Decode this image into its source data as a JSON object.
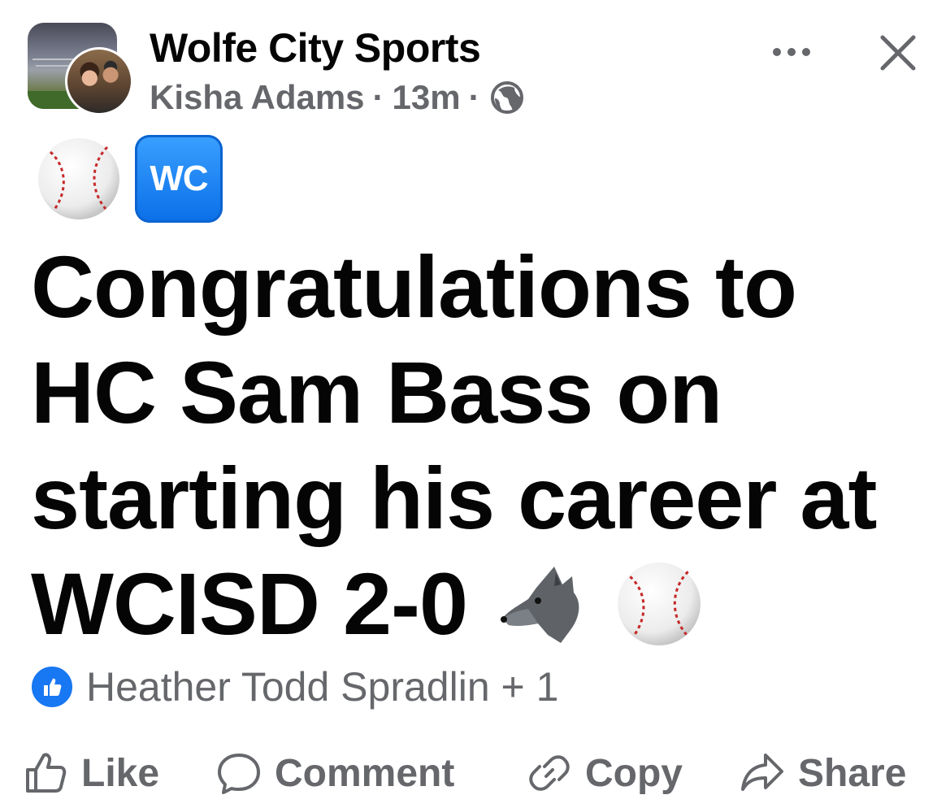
{
  "post": {
    "group_name": "Wolfe City Sports",
    "author": "Kisha Adams",
    "separator": "·",
    "time": "13m",
    "audience_icon": "globe-icon",
    "emoji_row": [
      "baseball-icon",
      "wc-icon"
    ],
    "wc_label": "WC",
    "body_lines": [
      "Congratulations to",
      "HC Sam Bass on",
      "starting his career at",
      "WCISD 2-0"
    ],
    "trailing_emoji": [
      "wolf-icon",
      "baseball-icon"
    ]
  },
  "reactions": {
    "icon": "like-icon",
    "names": "Heather Todd Spradlin + 1"
  },
  "actions": {
    "like": "Like",
    "comment": "Comment",
    "copy": "Copy",
    "share": "Share"
  },
  "colors": {
    "text_primary": "#050505",
    "text_secondary": "#65676b",
    "like_blue": "#1877f2"
  }
}
